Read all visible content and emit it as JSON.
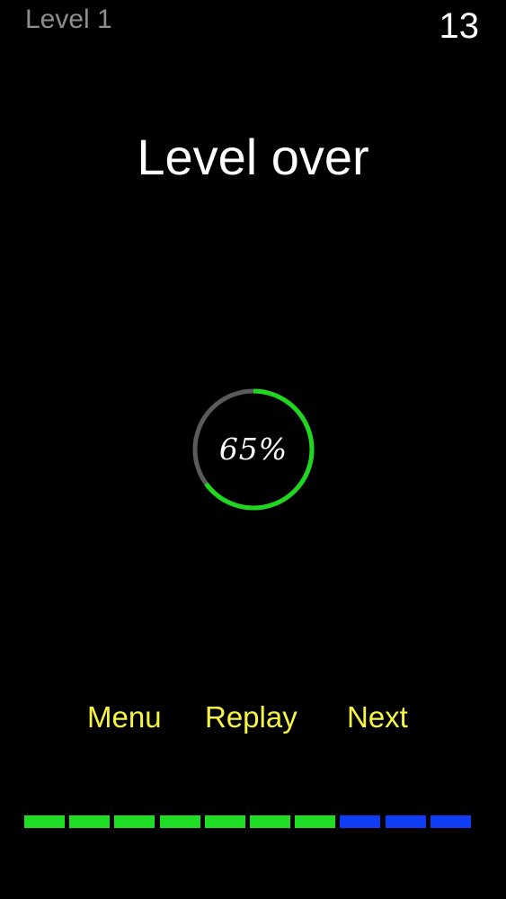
{
  "hud": {
    "level_label": "Level 1",
    "score": "13"
  },
  "title": "Level over",
  "progress": {
    "percent": 65,
    "label": "65%",
    "fill_color": "#1fd71f",
    "track_color": "#5b5b5b"
  },
  "actions": {
    "menu": "Menu",
    "replay": "Replay",
    "next": "Next"
  },
  "stages": {
    "completed_count": 7,
    "total": 10,
    "completed_color": "#1fdc24",
    "remaining_color": "#0f3cf5"
  }
}
